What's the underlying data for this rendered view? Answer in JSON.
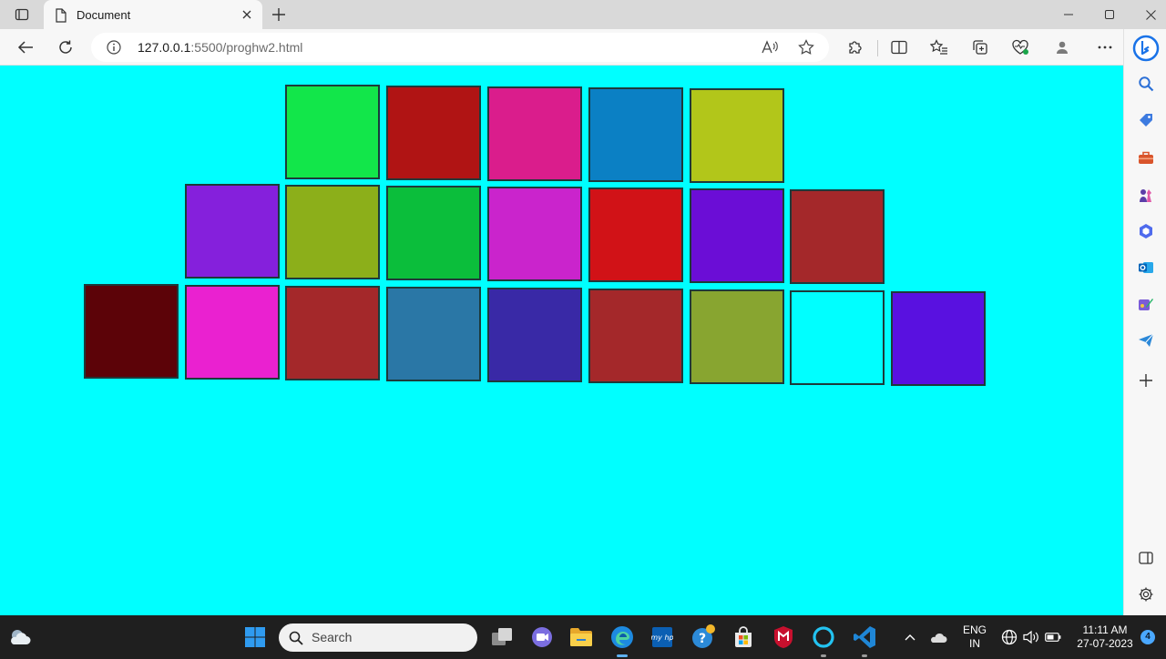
{
  "tab": {
    "title": "Document"
  },
  "address": {
    "host": "127.0.0.1",
    "path": ":5500/proghw2.html"
  },
  "page": {
    "background": "#00ffff",
    "rows": [
      [
        "#12e64a",
        "#b01414",
        "#da1d8c",
        "#0b80c4",
        "#b2c61a"
      ],
      [
        "#8520dc",
        "#8caf1a",
        "#0bbe3b",
        "#ca24cc",
        "#d11217",
        "#6b0dd6",
        "#a4282a"
      ],
      [
        "#5c0308",
        "#ea21d0",
        "#a4282a",
        "#2a77a6",
        "#3929a6",
        "#a4282a",
        "#88a530",
        "#00ffff",
        "#5911e0"
      ]
    ]
  },
  "taskbar": {
    "search_label": "Search",
    "lang_top": "ENG",
    "lang_bottom": "IN",
    "time": "11:11 AM",
    "date": "27-07-2023",
    "notifications": "4"
  }
}
